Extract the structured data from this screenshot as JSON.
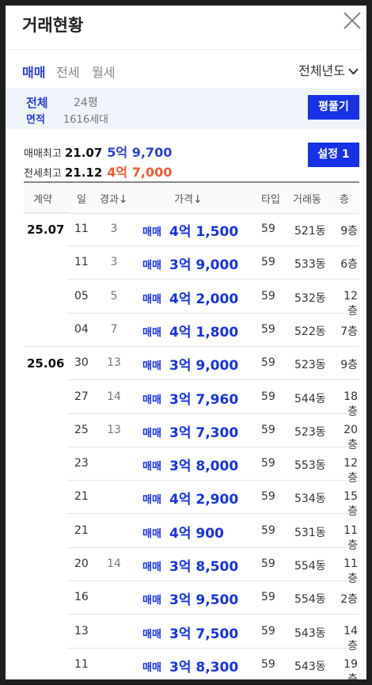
{
  "title": "거래현황",
  "tabs": [
    {
      "label": "매매",
      "active": true
    },
    {
      "label": "전세",
      "active": false
    },
    {
      "label": "월세",
      "active": false
    }
  ],
  "year_select": "전체년도",
  "area": {
    "label1": "전체",
    "label2": "면적",
    "pyeong": "24평",
    "households": "1616세대",
    "button": "평풀기"
  },
  "summary": {
    "sale_label": "매매최고",
    "sale_date": "21.07",
    "sale_price": "5억 9,700",
    "jeonse_label": "전세최고",
    "jeonse_date": "21.12",
    "jeonse_price": "4억 7,000",
    "setting_button": "설정 1"
  },
  "table": {
    "headers": {
      "contract": "계약",
      "day": "일",
      "elapsed": "경과",
      "price": "가격",
      "type": "타입",
      "dong": "거래동",
      "floor": "층",
      "sort_arrow": "↓"
    },
    "rows": [
      {
        "month": "25.07",
        "day": "11",
        "elapsed": "3",
        "deal": "매매",
        "price": "4억 1,500",
        "type": "59",
        "dong": "521동",
        "floor": "9층"
      },
      {
        "month": "",
        "day": "11",
        "elapsed": "3",
        "deal": "매매",
        "price": "3억 9,000",
        "type": "59",
        "dong": "533동",
        "floor": "6층"
      },
      {
        "month": "",
        "day": "05",
        "elapsed": "5",
        "deal": "매매",
        "price": "4억 2,000",
        "type": "59",
        "dong": "532동",
        "floor": "12층"
      },
      {
        "month": "",
        "day": "04",
        "elapsed": "7",
        "deal": "매매",
        "price": "4억 1,800",
        "type": "59",
        "dong": "522동",
        "floor": "7층"
      },
      {
        "month": "25.06",
        "day": "30",
        "elapsed": "13",
        "deal": "매매",
        "price": "3억 9,000",
        "type": "59",
        "dong": "523동",
        "floor": "9층"
      },
      {
        "month": "",
        "day": "27",
        "elapsed": "14",
        "deal": "매매",
        "price": "3억 7,960",
        "type": "59",
        "dong": "544동",
        "floor": "18층"
      },
      {
        "month": "",
        "day": "25",
        "elapsed": "13",
        "deal": "매매",
        "price": "3억 7,300",
        "type": "59",
        "dong": "523동",
        "floor": "20층"
      },
      {
        "month": "",
        "day": "23",
        "elapsed": "",
        "deal": "매매",
        "price": "3억 8,000",
        "type": "59",
        "dong": "553동",
        "floor": "12층"
      },
      {
        "month": "",
        "day": "21",
        "elapsed": "",
        "deal": "매매",
        "price": "4억 2,900",
        "type": "59",
        "dong": "534동",
        "floor": "15층"
      },
      {
        "month": "",
        "day": "21",
        "elapsed": "",
        "deal": "매매",
        "price": "4억 900",
        "type": "59",
        "dong": "531동",
        "floor": "11층"
      },
      {
        "month": "",
        "day": "20",
        "elapsed": "14",
        "deal": "매매",
        "price": "3억 8,500",
        "type": "59",
        "dong": "554동",
        "floor": "11층"
      },
      {
        "month": "",
        "day": "16",
        "elapsed": "",
        "deal": "매매",
        "price": "3억 9,500",
        "type": "59",
        "dong": "554동",
        "floor": "2층"
      },
      {
        "month": "",
        "day": "13",
        "elapsed": "",
        "deal": "매매",
        "price": "3억 7,500",
        "type": "59",
        "dong": "543동",
        "floor": "14층"
      },
      {
        "month": "",
        "day": "11",
        "elapsed": "",
        "deal": "매매",
        "price": "3억 8,300",
        "type": "59",
        "dong": "543동",
        "floor": "19층"
      }
    ]
  },
  "colors": {
    "accent": "#1732e6",
    "sale_high": "#2a3fd6",
    "jeonse_high": "#f05a32"
  }
}
